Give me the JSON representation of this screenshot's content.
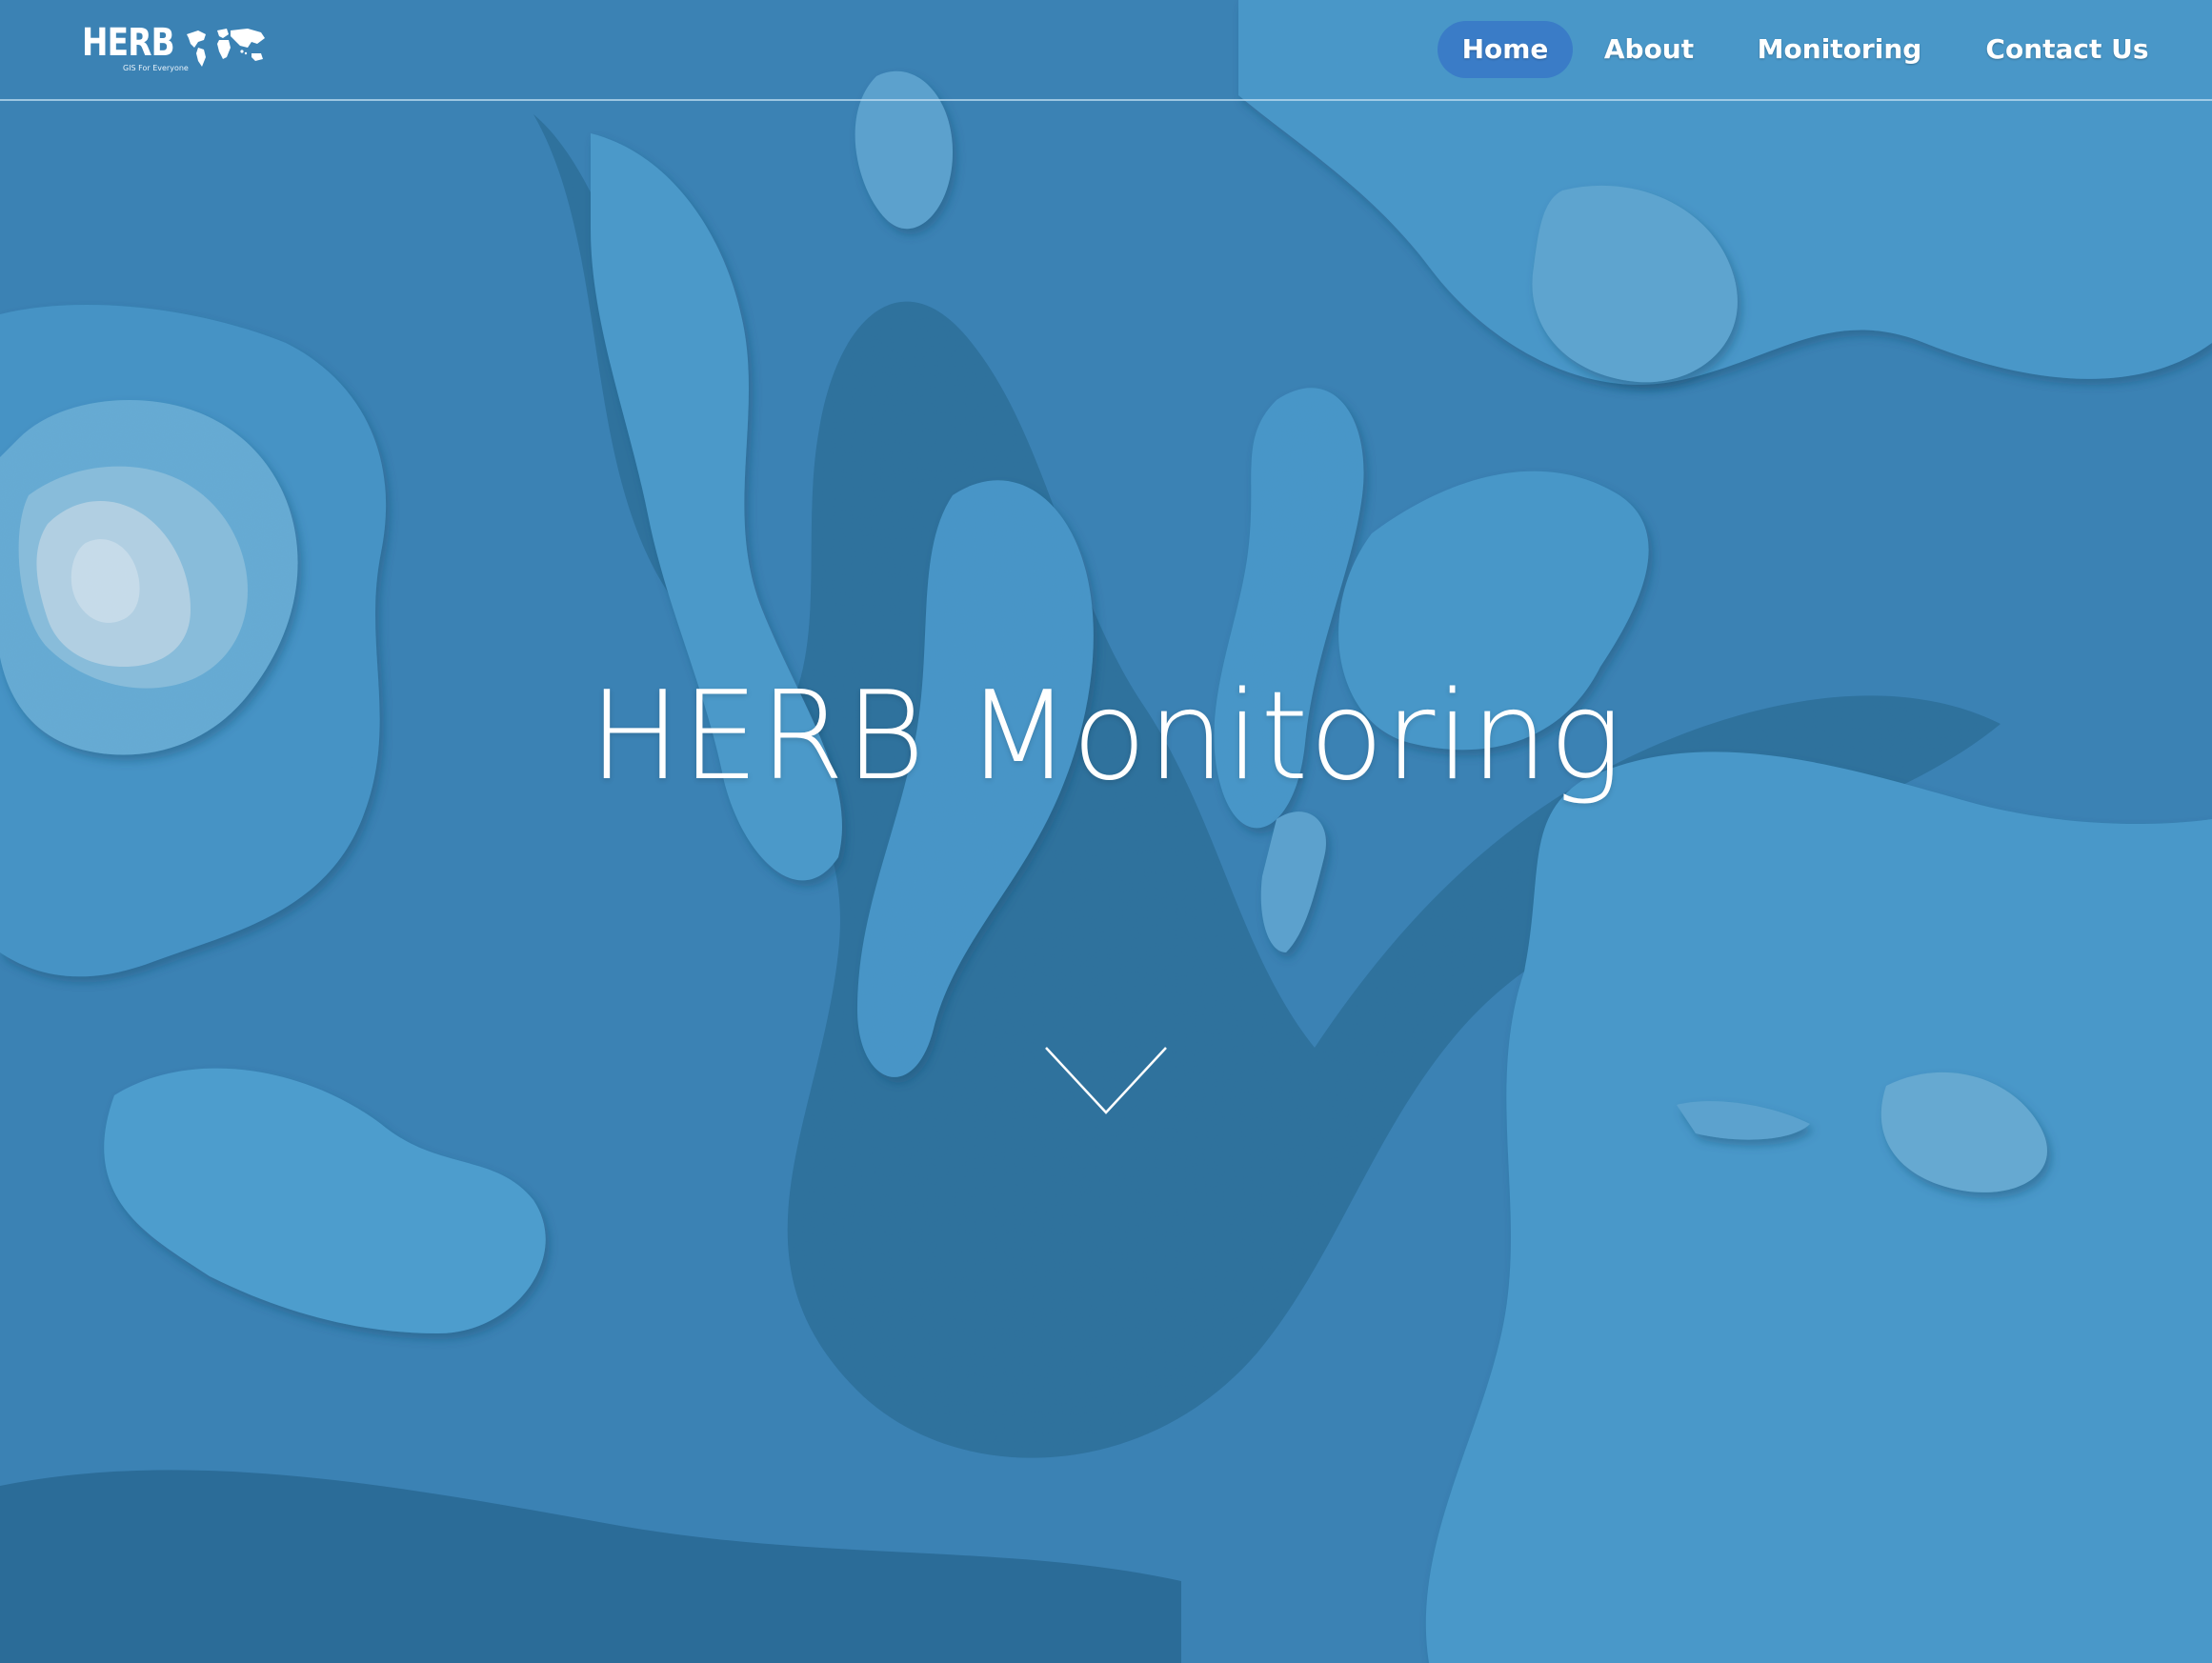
{
  "brand": {
    "name": "HERB",
    "tagline": "GIS For Everyone"
  },
  "nav": {
    "items": [
      {
        "label": "Home",
        "active": true
      },
      {
        "label": "About",
        "active": false
      },
      {
        "label": "Monitoring",
        "active": false
      },
      {
        "label": "Contact Us",
        "active": false
      }
    ]
  },
  "hero": {
    "title": "HERB Monitoring",
    "scroll_icon": "chevron-down-icon"
  },
  "colors": {
    "background": "#3f8cc0",
    "active_pill": "#3a7cc7",
    "text": "#ffffff"
  }
}
